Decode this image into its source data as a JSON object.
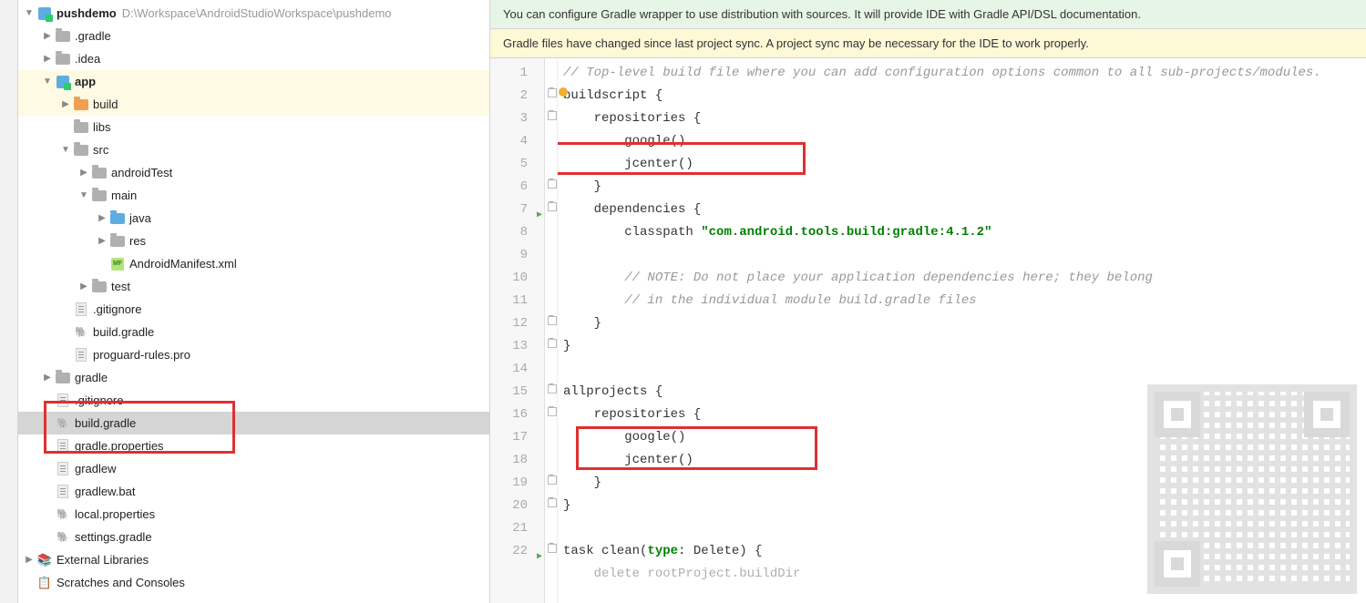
{
  "project": {
    "name": "pushdemo",
    "path": "D:\\Workspace\\AndroidStudioWorkspace\\pushdemo"
  },
  "tree": {
    "gradle_dir": ".gradle",
    "idea_dir": ".idea",
    "app": "app",
    "build": "build",
    "libs": "libs",
    "src": "src",
    "androidTest": "androidTest",
    "main": "main",
    "java": "java",
    "res": "res",
    "manifest": "AndroidManifest.xml",
    "test": "test",
    "gitignore": ".gitignore",
    "build_gradle": "build.gradle",
    "proguard": "proguard-rules.pro",
    "gradle_folder": "gradle",
    "gitignore2": ".gitignore",
    "build_gradle_root": "build.gradle",
    "gradle_properties": "gradle.properties",
    "gradlew": "gradlew",
    "gradlew_bat": "gradlew.bat",
    "local_properties": "local.properties",
    "settings_gradle": "settings.gradle",
    "external_libs": "External Libraries",
    "scratches": "Scratches and Consoles"
  },
  "banners": {
    "wrapper": "You can configure Gradle wrapper to use distribution with sources. It will provide IDE with Gradle API/DSL documentation.",
    "sync": "Gradle files have changed since last project sync. A project sync may be necessary for the IDE to work properly."
  },
  "code": {
    "l1": "// Top-level build file where you can add configuration options common to all sub-projects/modules.",
    "l2a": "buildscript ",
    "l2b": "{",
    "l3": "    repositories {",
    "l4": "        google()",
    "l5": "        jcenter()",
    "l6": "    }",
    "l7": "    dependencies {",
    "l8a": "        classpath ",
    "l8b": "\"com.android.tools.build:gradle:4.1.2\"",
    "l9": "",
    "l10": "        // NOTE: Do not place your application dependencies here; they belong",
    "l11": "        // in the individual module build.gradle files",
    "l12": "    }",
    "l13": "}",
    "l14": "",
    "l15a": "allprojects ",
    "l15b": "{",
    "l16": "    repositories {",
    "l17": "        google()",
    "l18": "        jcenter()",
    "l19": "    }",
    "l20": "}",
    "l21": "",
    "l22a": "task clean(",
    "l22b": "type",
    "l22c": ": Delete) {",
    "l23": "    delete rootProject.buildDir"
  },
  "line_numbers": [
    "1",
    "2",
    "3",
    "4",
    "5",
    "6",
    "7",
    "8",
    "9",
    "10",
    "11",
    "12",
    "13",
    "14",
    "15",
    "16",
    "17",
    "18",
    "19",
    "20",
    "21",
    "22"
  ]
}
